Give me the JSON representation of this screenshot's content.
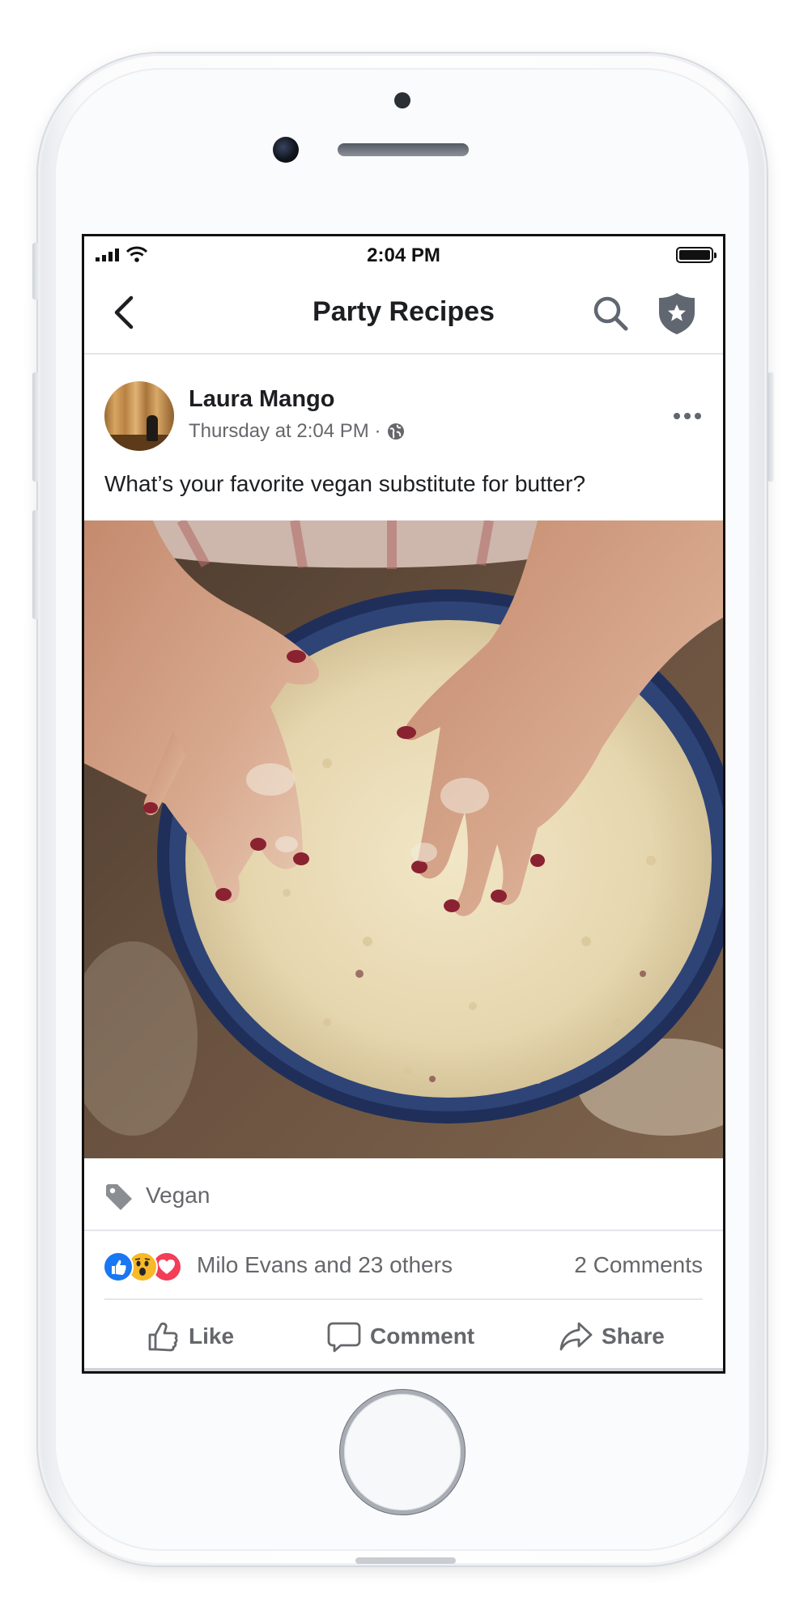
{
  "status_bar": {
    "time": "2:04 PM",
    "signal_icon": "cellular-signal-icon",
    "wifi_icon": "wifi-icon",
    "battery_icon": "battery-full-icon"
  },
  "nav": {
    "title": "Party Recipes",
    "back_icon": "chevron-left-icon",
    "search_icon": "search-icon",
    "shield_icon": "admin-shield-star-icon"
  },
  "post": {
    "author": "Laura Mango",
    "timestamp": "Thursday at 2:04 PM ·",
    "privacy_icon": "globe-icon",
    "more_icon": "more-dots-icon",
    "text": "What’s your favorite vegan substitute for butter?",
    "photo_description_icon": "photo-image",
    "tag": "Vegan",
    "tag_icon": "tag-icon"
  },
  "reactions": {
    "icons": [
      "like-reaction-icon",
      "wow-reaction-icon",
      "love-reaction-icon"
    ],
    "summary": "Milo Evans and 23 others",
    "comments": "2 Comments"
  },
  "actions": {
    "like": "Like",
    "comment": "Comment",
    "share": "Share"
  },
  "colors": {
    "brand_blue": "#1877f2",
    "wow_yellow": "#f7b928",
    "love_red": "#f33e58",
    "secondary_text": "#65676b",
    "primary_text": "#1c1e21"
  }
}
